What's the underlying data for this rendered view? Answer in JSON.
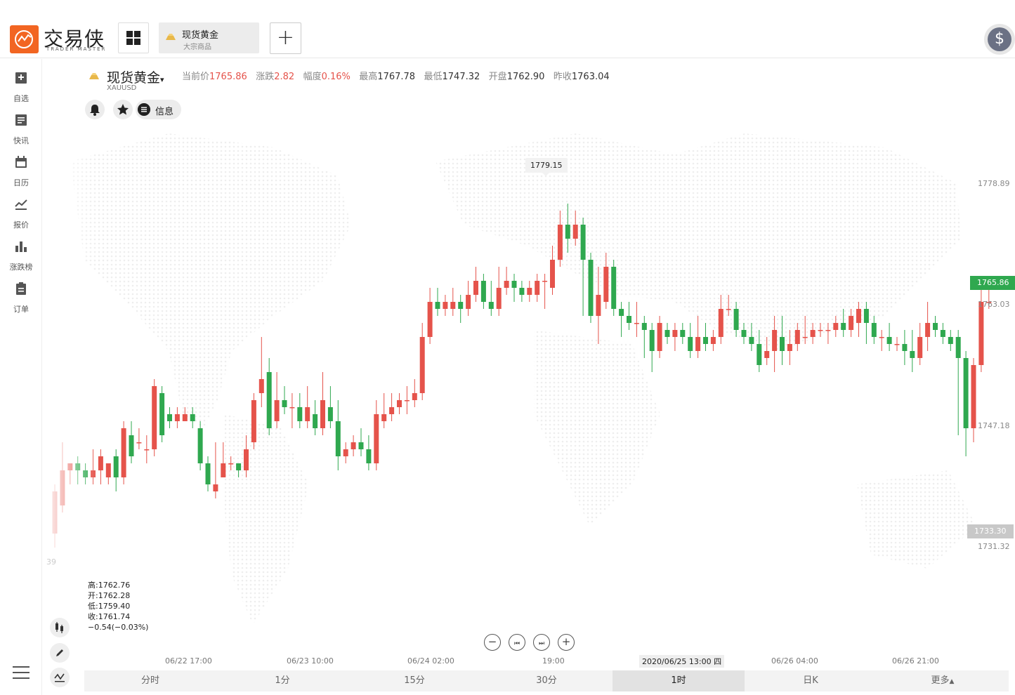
{
  "app": {
    "logo_name": "交易侠",
    "logo_sub": "TRADER MASTER",
    "colors": {
      "up": "#e5534b",
      "down": "#2fa84f",
      "brand": "#f26522"
    }
  },
  "tab": {
    "title": "现货黄金",
    "subtitle": "大宗商品"
  },
  "sidebar": {
    "items": [
      {
        "label": "自选",
        "icon": "bookmark-plus-icon"
      },
      {
        "label": "快讯",
        "icon": "news-icon"
      },
      {
        "label": "日历",
        "icon": "calendar-icon"
      },
      {
        "label": "报价",
        "icon": "line-chart-icon"
      },
      {
        "label": "涨跌榜",
        "icon": "bar-chart-icon"
      },
      {
        "label": "订单",
        "icon": "clipboard-icon"
      }
    ]
  },
  "quote": {
    "name": "现货黄金",
    "code": "XAUUSD",
    "current_label": "当前价",
    "current": "1765.86",
    "change_label": "涨跌",
    "change": "2.82",
    "pct_label": "幅度",
    "pct": "0.16%",
    "high_label": "最高",
    "high": "1767.78",
    "low_label": "最低",
    "low": "1747.32",
    "open_label": "开盘",
    "open": "1762.90",
    "prev_label": "昨收",
    "prev": "1763.04"
  },
  "tools": {
    "info_label": "信息"
  },
  "ohlc_panel": {
    "high": "高:1762.76",
    "open": "开:1762.28",
    "low": "低:1759.40",
    "close": "收:1761.74",
    "change": "−0.54(−0.03%)"
  },
  "chart": {
    "peak_label": "1779.15",
    "y_labels": [
      "1778.89",
      "1763.03",
      "1747.18",
      "1731.32"
    ],
    "last_price": "1765.86",
    "faded_price": "1733.30",
    "faded_axis": "39",
    "x_labels": [
      "06/22 17:00",
      "06/23 10:00",
      "06/24 02:00",
      "19:00",
      "2020/06/25 13:00 四",
      "06/26 04:00",
      "06/26 21:00"
    ]
  },
  "chart_data": {
    "type": "candlestick",
    "title": "",
    "xlabel": "",
    "ylabel": "",
    "ylim": [
      1727,
      1784
    ],
    "candles": [
      [
        1732,
        1738,
        1730,
        1739
      ],
      [
        1736,
        1741,
        1735,
        1745
      ],
      [
        1741,
        1742,
        1739,
        1742
      ],
      [
        1742,
        1741,
        1739,
        1743
      ],
      [
        1741,
        1740,
        1739,
        1742
      ],
      [
        1740,
        1741,
        1739,
        1744
      ],
      [
        1741,
        1743,
        1739,
        1744
      ],
      [
        1740,
        1742,
        1739,
        1742
      ],
      [
        1743,
        1740,
        1738,
        1744
      ],
      [
        1740,
        1747,
        1739,
        1748
      ],
      [
        1746,
        1743,
        1742,
        1748
      ],
      [
        1745,
        1745,
        1744,
        1747
      ],
      [
        1744,
        1744,
        1742,
        1746
      ],
      [
        1744,
        1753,
        1743,
        1754
      ],
      [
        1752,
        1746,
        1745,
        1753
      ],
      [
        1749,
        1748,
        1747,
        1750
      ],
      [
        1748,
        1749,
        1747,
        1750
      ],
      [
        1748,
        1749,
        1748,
        1750
      ],
      [
        1749,
        1748,
        1747,
        1750
      ],
      [
        1747,
        1742,
        1741,
        1748
      ],
      [
        1742,
        1739,
        1738,
        1743
      ],
      [
        1738,
        1739,
        1737,
        1745
      ],
      [
        1740,
        1742,
        1740,
        1745
      ],
      [
        1742,
        1742,
        1741,
        1743
      ],
      [
        1742,
        1741,
        1740,
        1742
      ],
      [
        1741,
        1744,
        1740,
        1746
      ],
      [
        1745,
        1751,
        1744,
        1752
      ],
      [
        1752,
        1754,
        1750,
        1760
      ],
      [
        1755,
        1747,
        1746,
        1757
      ],
      [
        1748,
        1751,
        1747,
        1755
      ],
      [
        1751,
        1750,
        1749,
        1753
      ],
      [
        1750,
        1750,
        1747,
        1752
      ],
      [
        1750,
        1748,
        1747,
        1752
      ],
      [
        1748,
        1750,
        1747,
        1753
      ],
      [
        1749,
        1747,
        1746,
        1751
      ],
      [
        1747,
        1751,
        1746,
        1755
      ],
      [
        1750,
        1748,
        1747,
        1753
      ],
      [
        1748,
        1743,
        1741,
        1751
      ],
      [
        1743,
        1744,
        1742,
        1745
      ],
      [
        1744,
        1745,
        1743,
        1746
      ],
      [
        1745,
        1744,
        1743,
        1747
      ],
      [
        1744,
        1742,
        1741,
        1746
      ],
      [
        1742,
        1749,
        1741,
        1751
      ],
      [
        1748,
        1749,
        1747,
        1752
      ],
      [
        1749,
        1750,
        1748,
        1752
      ],
      [
        1750,
        1751,
        1749,
        1752
      ],
      [
        1751,
        1751,
        1749,
        1753
      ],
      [
        1751,
        1752,
        1750,
        1754
      ],
      [
        1752,
        1760,
        1751,
        1762
      ],
      [
        1760,
        1765,
        1759,
        1767
      ],
      [
        1765,
        1764,
        1763,
        1767
      ],
      [
        1764,
        1765,
        1763,
        1766
      ],
      [
        1764,
        1765,
        1763,
        1767
      ],
      [
        1765,
        1764,
        1762,
        1766
      ],
      [
        1764,
        1766,
        1763,
        1768
      ],
      [
        1766,
        1768,
        1765,
        1770
      ],
      [
        1768,
        1765,
        1764,
        1769
      ],
      [
        1765,
        1764,
        1763,
        1768
      ],
      [
        1764,
        1767,
        1763,
        1770
      ],
      [
        1767,
        1768,
        1766,
        1770
      ],
      [
        1768,
        1767,
        1765,
        1769
      ],
      [
        1767,
        1766,
        1765,
        1768
      ],
      [
        1766,
        1767,
        1765,
        1768
      ],
      [
        1766,
        1768,
        1765,
        1769
      ],
      [
        1768,
        1768,
        1764,
        1769
      ],
      [
        1767,
        1771,
        1766,
        1773
      ],
      [
        1771,
        1776,
        1770,
        1778
      ],
      [
        1776,
        1774,
        1772,
        1779
      ],
      [
        1774,
        1776,
        1773,
        1778
      ],
      [
        1776,
        1771,
        1763,
        1777
      ],
      [
        1771,
        1763,
        1762,
        1772
      ],
      [
        1763,
        1766,
        1759,
        1770
      ],
      [
        1765,
        1770,
        1764,
        1772
      ],
      [
        1770,
        1764,
        1763,
        1771
      ],
      [
        1764,
        1763,
        1760,
        1765
      ],
      [
        1763,
        1762,
        1761,
        1765
      ],
      [
        1762,
        1762,
        1760,
        1765
      ],
      [
        1762,
        1761,
        1757,
        1763
      ],
      [
        1761,
        1758,
        1755,
        1762
      ],
      [
        1758,
        1762,
        1757,
        1763
      ],
      [
        1761,
        1760,
        1759,
        1762
      ],
      [
        1760,
        1761,
        1758,
        1762
      ],
      [
        1761,
        1760,
        1759,
        1762
      ],
      [
        1760,
        1758,
        1757,
        1762
      ],
      [
        1758,
        1760,
        1757,
        1763
      ],
      [
        1760,
        1759,
        1758,
        1762
      ],
      [
        1759,
        1760,
        1758,
        1761
      ],
      [
        1760,
        1764,
        1759,
        1766
      ],
      [
        1764,
        1764,
        1763,
        1766
      ],
      [
        1764,
        1761,
        1760,
        1765
      ],
      [
        1761,
        1760,
        1759,
        1762
      ],
      [
        1760,
        1759,
        1758,
        1762
      ],
      [
        1759,
        1756,
        1755,
        1761
      ],
      [
        1757,
        1758,
        1756,
        1760
      ],
      [
        1758,
        1761,
        1755,
        1763
      ],
      [
        1760,
        1758,
        1756,
        1763
      ],
      [
        1758,
        1759,
        1756,
        1761
      ],
      [
        1759,
        1761,
        1758,
        1762
      ],
      [
        1760,
        1760,
        1759,
        1763
      ],
      [
        1760,
        1761,
        1759,
        1762
      ],
      [
        1761,
        1761,
        1760,
        1762
      ],
      [
        1761,
        1761,
        1759,
        1762
      ],
      [
        1761,
        1762,
        1760,
        1763
      ],
      [
        1762,
        1761,
        1760,
        1764
      ],
      [
        1761,
        1763,
        1760,
        1764
      ],
      [
        1762,
        1764,
        1760,
        1765
      ],
      [
        1764,
        1762,
        1759,
        1765
      ],
      [
        1762,
        1760,
        1759,
        1763
      ],
      [
        1760,
        1760,
        1758,
        1761
      ],
      [
        1760,
        1759,
        1758,
        1762
      ],
      [
        1759,
        1759,
        1758,
        1760
      ],
      [
        1759,
        1758,
        1756,
        1761
      ],
      [
        1758,
        1757,
        1755,
        1761
      ],
      [
        1757,
        1760,
        1756,
        1762
      ],
      [
        1760,
        1762,
        1758,
        1765
      ],
      [
        1762,
        1761,
        1760,
        1763
      ],
      [
        1761,
        1760,
        1759,
        1762
      ],
      [
        1760,
        1759,
        1758,
        1761
      ],
      [
        1760,
        1757,
        1746,
        1761
      ],
      [
        1757,
        1747,
        1743,
        1758
      ],
      [
        1747,
        1756,
        1745,
        1757
      ],
      [
        1756,
        1765,
        1755,
        1768
      ],
      [
        1765,
        1765,
        1764,
        1767
      ]
    ]
  },
  "timeframes": [
    "分时",
    "1分",
    "15分",
    "30分",
    "1时",
    "日K",
    "更多"
  ],
  "active_timeframe": "1时"
}
